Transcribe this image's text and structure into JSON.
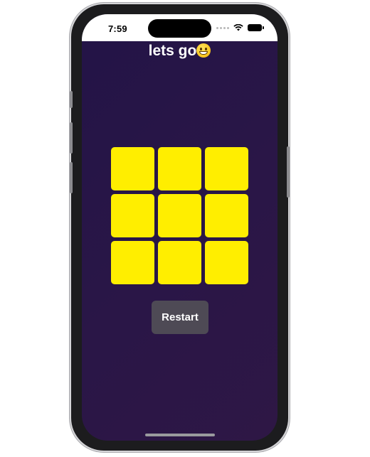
{
  "status_bar": {
    "time": "7:59",
    "wifi_icon": "wifi-icon",
    "battery_icon": "battery-icon"
  },
  "header": {
    "title": "lets go",
    "emoji_icon": "grinning-face-icon"
  },
  "board": {
    "cells": [
      "",
      "",
      "",
      "",
      "",
      "",
      "",
      "",
      ""
    ],
    "cell_color": "#ffee00"
  },
  "controls": {
    "restart_label": "Restart"
  },
  "colors": {
    "background": "#2a1647",
    "button": "#4e4a55",
    "title_text": "#ffffff"
  }
}
